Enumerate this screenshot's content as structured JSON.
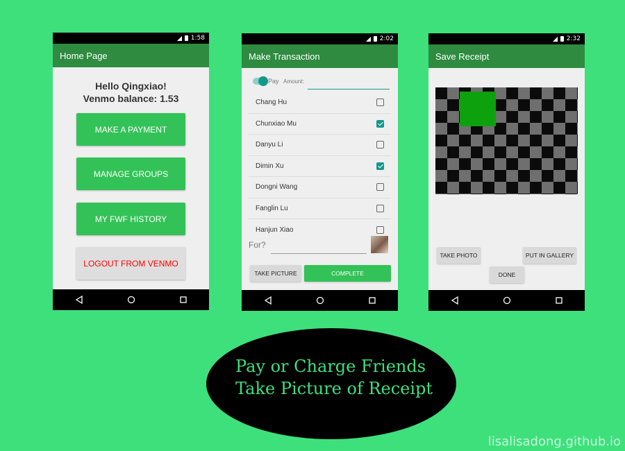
{
  "colors": {
    "background": "#3ee07c",
    "appbar": "#2e8b40",
    "accent_green": "#33c257",
    "teal": "#14988a",
    "logout_red": "#ff0000"
  },
  "home": {
    "status_time": "1:58",
    "title": "Home Page",
    "greeting": "Hello Qingxiao!",
    "balance": "Venmo balance: 1.53",
    "buttons": [
      "MAKE A PAYMENT",
      "MANAGE GROUPS",
      "MY FWF HISTORY",
      "LOGOUT FROM VENMO"
    ]
  },
  "transaction": {
    "status_time": "2:02",
    "title": "Make Transaction",
    "toggle_label": "Pay",
    "amount_label": "Amount:",
    "contacts": [
      {
        "name": "Chang Hu",
        "checked": false
      },
      {
        "name": "Chunxiao Mu",
        "checked": true
      },
      {
        "name": "Danyu Li",
        "checked": false
      },
      {
        "name": "Dimin Xu",
        "checked": true
      },
      {
        "name": "Dongni Wang",
        "checked": false
      },
      {
        "name": "Fanglin Lu",
        "checked": false
      },
      {
        "name": "Hanjun Xiao",
        "checked": false
      }
    ],
    "for_placeholder": "For?",
    "take_picture": "TAKE PICTURE",
    "complete": "COMPLETE"
  },
  "receipt": {
    "status_time": "2:32",
    "title": "Save Receipt",
    "take_photo": "TAKE PHOTO",
    "put_in_gallery": "PUT IN GALLERY",
    "done": "DONE"
  },
  "caption": {
    "line1": "Pay or Charge Friends",
    "line2": "Take Picture of Receipt"
  },
  "watermark": "lisalisadong.github.io"
}
